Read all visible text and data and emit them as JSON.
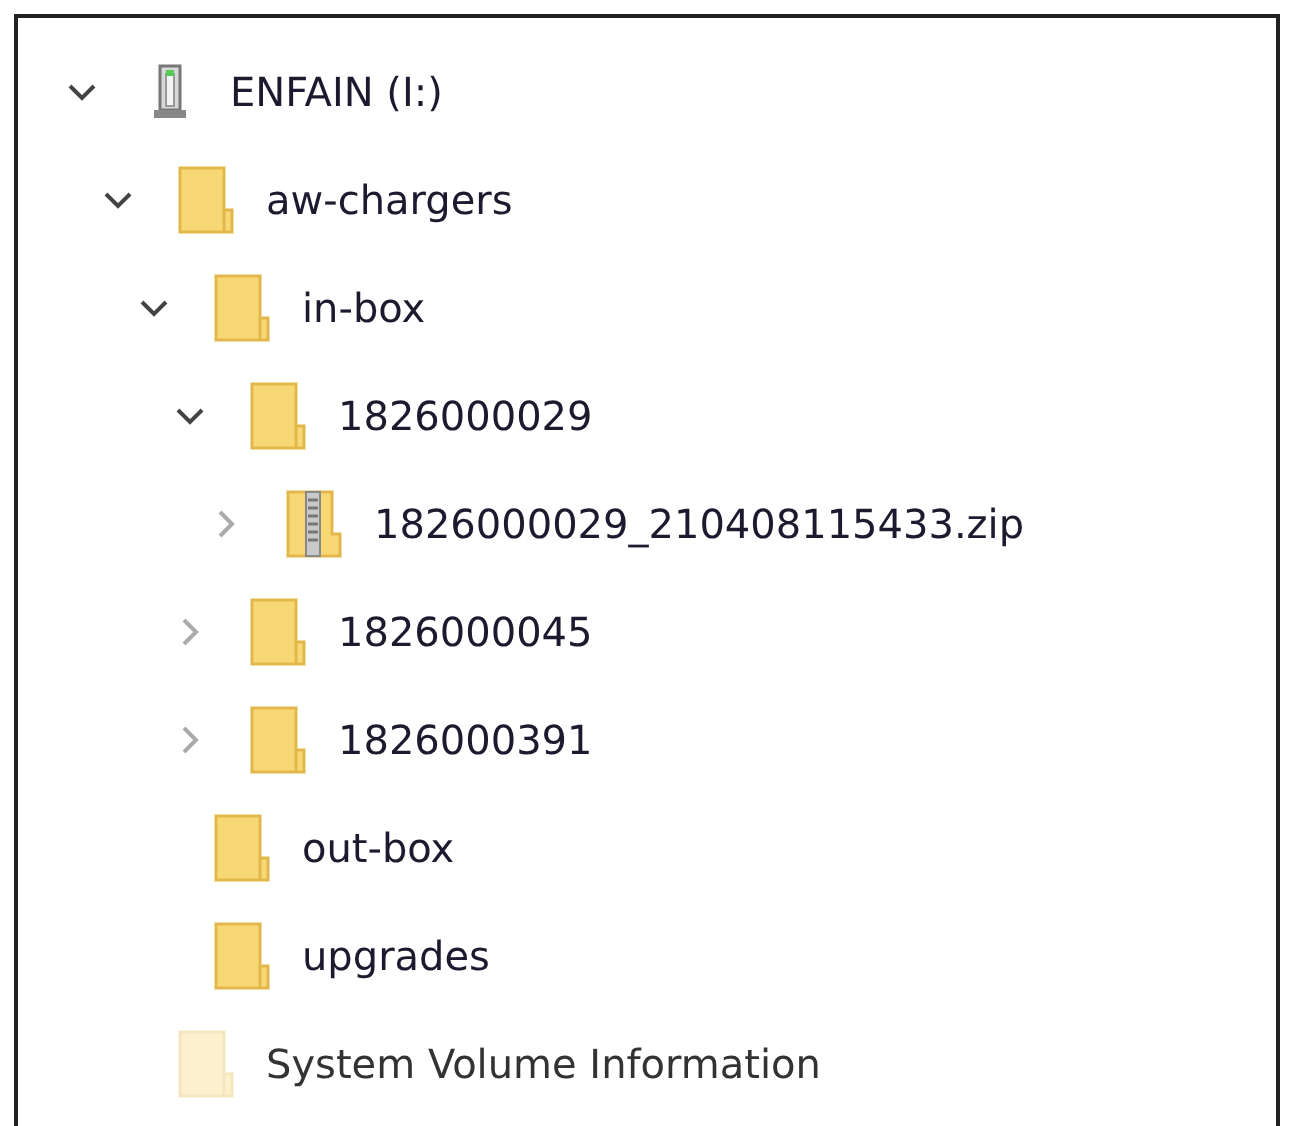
{
  "tree": [
    {
      "label": "ENFAIN (I:)",
      "kind": "drive",
      "expanded": true,
      "hidden": false,
      "children": [
        {
          "label": "aw-chargers",
          "kind": "folder",
          "expanded": true,
          "hidden": false,
          "children": [
            {
              "label": "in-box",
              "kind": "folder",
              "expanded": true,
              "hidden": false,
              "children": [
                {
                  "label": "1826000029",
                  "kind": "folder",
                  "expanded": true,
                  "hidden": false,
                  "children": [
                    {
                      "label": "1826000029_210408115433.zip",
                      "kind": "zip",
                      "expanded": false,
                      "hidden": false
                    }
                  ]
                },
                {
                  "label": "1826000045",
                  "kind": "folder",
                  "expanded": false,
                  "hidden": false
                },
                {
                  "label": "1826000391",
                  "kind": "folder",
                  "expanded": false,
                  "hidden": false
                }
              ]
            },
            {
              "label": "out-box",
              "kind": "folder",
              "hidden": false
            },
            {
              "label": "upgrades",
              "kind": "folder",
              "hidden": false
            }
          ]
        },
        {
          "label": "System Volume Information",
          "kind": "folder",
          "hidden": true
        }
      ]
    }
  ]
}
